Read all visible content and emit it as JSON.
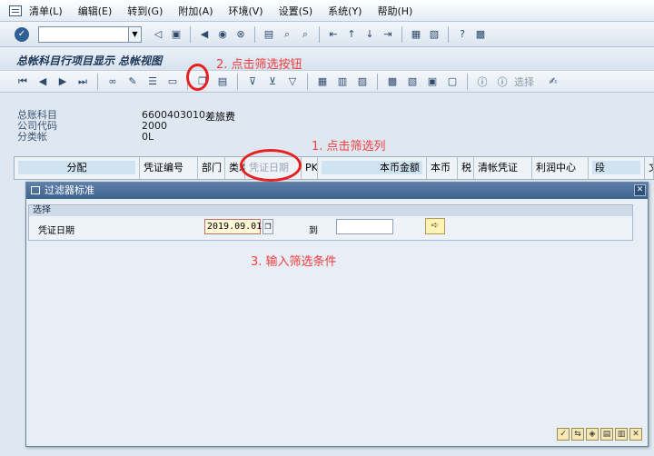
{
  "menu": {
    "items": [
      "清单(L)",
      "编辑(E)",
      "转到(G)",
      "附加(A)",
      "环境(V)",
      "设置(S)",
      "系统(Y)",
      "帮助(H)"
    ]
  },
  "command_field": {
    "value": ""
  },
  "title": "总帐科目行项目显示 总帐视图",
  "app_toolbar": {
    "select_label": "选择"
  },
  "header_info": {
    "labels": [
      "总账科目",
      "公司代码",
      "分类帐"
    ],
    "account": "6600403010",
    "account_desc": "差旅费",
    "company_code": "2000",
    "ledger": "0L"
  },
  "grid": {
    "columns": [
      "分配",
      "凭证编号",
      "部门",
      "类X",
      "凭证日期",
      "PK",
      "本币金额",
      "本币",
      "税",
      "清帐凭证",
      "利润中心",
      "段",
      "文"
    ]
  },
  "dialog": {
    "title": "过滤器标准",
    "group_title": "选择",
    "field_label": "凭证日期",
    "from_value": "2019.09.01",
    "to_label": "到",
    "to_value": ""
  },
  "annotations": {
    "step1": "1. 点击筛选列",
    "step2": "2. 点击筛选按钮",
    "step3": "3. 输入筛选条件"
  },
  "colors": {
    "annotation": "#f03d3d",
    "ring": "#e82020",
    "title_bar": "#3f6390"
  }
}
